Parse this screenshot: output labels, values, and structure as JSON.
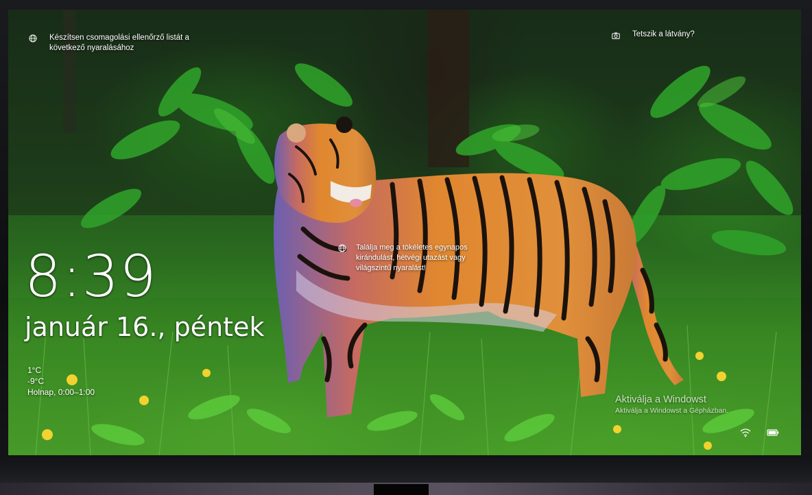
{
  "lock_screen": {
    "top_tip": "Készítsen csomagolási ellenőrző listát a következő nyaralásához",
    "camera_prompt": "Tetszik a látvány?",
    "middle_tip": "Találja meg a tökéletes egynapos kirándulást, hétvégi utazást vagy világszintű nyaralást!",
    "time": "8:39",
    "date": "január 16., péntek",
    "weather": {
      "high": "1°C",
      "low": "-9°C",
      "forecast": "Holnap, 0:00–1:00"
    },
    "activation": {
      "title": "Aktiválja a Windowst",
      "subtitle": "Aktiválja a Windowst a Gépházban."
    },
    "icons": {
      "top_tip": "globe-icon",
      "camera": "camera-icon",
      "middle_tip": "globe-icon",
      "network": "wifi-icon",
      "battery": "battery-icon"
    }
  },
  "colors": {
    "text": "#ffffff",
    "foliage": "#2f8a22",
    "tiger_orange": "#d9822b"
  }
}
